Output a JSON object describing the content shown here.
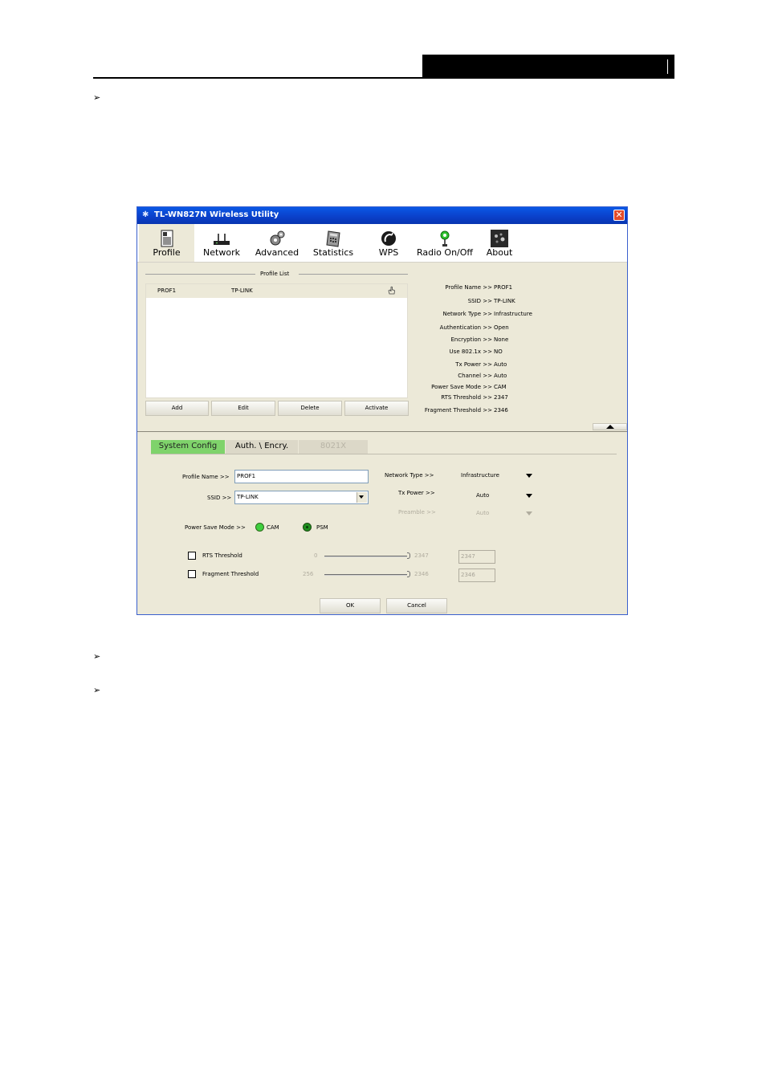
{
  "window": {
    "title": "TL-WN827N Wireless Utility",
    "close_glyph": "✕"
  },
  "toolbar": [
    {
      "label": "Profile",
      "icon": "profile-icon"
    },
    {
      "label": "Network",
      "icon": "network-icon"
    },
    {
      "label": "Advanced",
      "icon": "advanced-icon"
    },
    {
      "label": "Statistics",
      "icon": "statistics-icon"
    },
    {
      "label": "WPS",
      "icon": "wps-icon"
    },
    {
      "label": "Radio On/Off",
      "icon": "radio-icon"
    },
    {
      "label": "About",
      "icon": "about-icon"
    }
  ],
  "profile_list": {
    "heading": "Profile List",
    "rows": [
      {
        "name": "PROF1",
        "ssid": "TP-LINK"
      }
    ],
    "buttons": {
      "add": "Add",
      "edit": "Edit",
      "delete": "Delete",
      "activate": "Activate"
    }
  },
  "info": [
    {
      "label": "Profile Name >>",
      "value": "PROF1"
    },
    {
      "label": "SSID >>",
      "value": "TP-LINK"
    },
    {
      "label": "Network Type >>",
      "value": "Infrastructure"
    },
    {
      "label": "Authentication >>",
      "value": "Open"
    },
    {
      "label": "Encryption >>",
      "value": "None"
    },
    {
      "label": "Use 802.1x >>",
      "value": "NO"
    },
    {
      "label": "Tx Power >>",
      "value": "Auto"
    },
    {
      "label": "Channel >>",
      "value": "Auto"
    },
    {
      "label": "Power Save Mode >>",
      "value": "CAM"
    },
    {
      "label": "RTS Threshold >>",
      "value": "2347"
    },
    {
      "label": "Fragment Threshold >>",
      "value": "2346"
    }
  ],
  "tabs": {
    "system_config": "System Config",
    "auth": "Auth. \\ Encry.",
    "x8021": "8021X"
  },
  "config": {
    "profile_name_label": "Profile Name >>",
    "profile_name_value": "PROF1",
    "ssid_label": "SSID >>",
    "ssid_value": "TP-LINK",
    "network_type_label": "Network Type >>",
    "network_type_value": "Infrastructure",
    "tx_power_label": "Tx Power >>",
    "tx_power_value": "Auto",
    "preamble_label": "Preamble >>",
    "preamble_value": "Auto",
    "power_save_label": "Power Save Mode >>",
    "cam_label": "CAM",
    "psm_label": "PSM",
    "rts_label": "RTS Threshold",
    "rts_min": "0",
    "rts_max": "2347",
    "rts_value": "2347",
    "frag_label": "Fragment Threshold",
    "frag_min": "256",
    "frag_max": "2346",
    "frag_value": "2346",
    "ok_label": "OK",
    "cancel_label": "Cancel"
  },
  "bullet_glyph": "➢"
}
